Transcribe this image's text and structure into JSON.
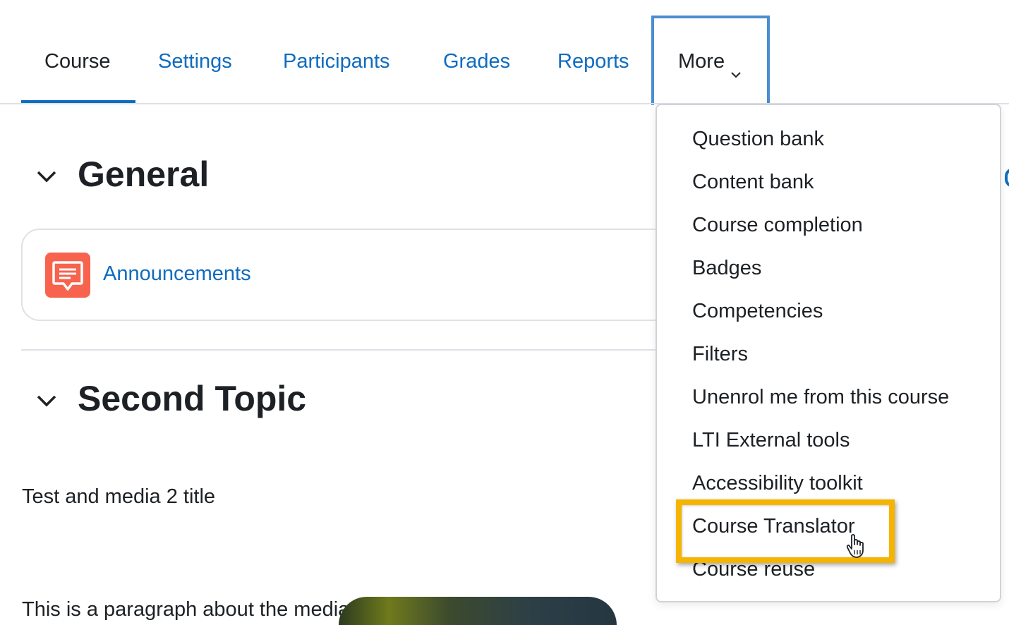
{
  "nav": {
    "tabs": [
      {
        "label": "Course",
        "active": true
      },
      {
        "label": "Settings"
      },
      {
        "label": "Participants"
      },
      {
        "label": "Grades"
      },
      {
        "label": "Reports"
      }
    ],
    "more_label": "More",
    "more_icon": "chevron-down-icon"
  },
  "sections": [
    {
      "title": "General",
      "toggle_icon": "chevron-down-icon"
    },
    {
      "title": "Second Topic",
      "toggle_icon": "chevron-down-icon"
    }
  ],
  "activity": {
    "label": "Announcements",
    "icon": "forum-icon",
    "icon_color": "#f7634d"
  },
  "content": {
    "text": "Test and media 2 title",
    "partial_text": "This is a paragraph about the media clip"
  },
  "menu": {
    "items": [
      {
        "label": "Question bank"
      },
      {
        "label": "Content bank"
      },
      {
        "label": "Course completion"
      },
      {
        "label": "Badges"
      },
      {
        "label": "Competencies"
      },
      {
        "label": "Filters"
      },
      {
        "label": "Unenrol me from this course"
      },
      {
        "label": "LTI External tools"
      },
      {
        "label": "Accessibility toolkit"
      },
      {
        "label": "Course Translator",
        "highlighted": true
      },
      {
        "label": "Course reuse"
      }
    ]
  },
  "colors": {
    "link": "#0f6cbf",
    "text": "#1d2125",
    "highlight": "#f5b400",
    "focus_outline": "#4a8ecf"
  }
}
